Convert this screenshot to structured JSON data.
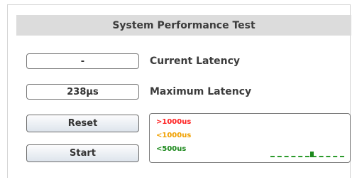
{
  "title": "System Performance Test",
  "current_latency": {
    "value": "-",
    "label": "Current Latency"
  },
  "maximum_latency": {
    "value": "238µs",
    "label": "Maximum Latency"
  },
  "buttons": {
    "reset": "Reset",
    "start": "Start"
  },
  "monitor": {
    "legend": [
      {
        "text": ">1000us",
        "color": "#ff2020"
      },
      {
        "text": "<1000us",
        "color": "#f0a000"
      },
      {
        "text": "<500us",
        "color": "#1e8a1e"
      }
    ]
  }
}
